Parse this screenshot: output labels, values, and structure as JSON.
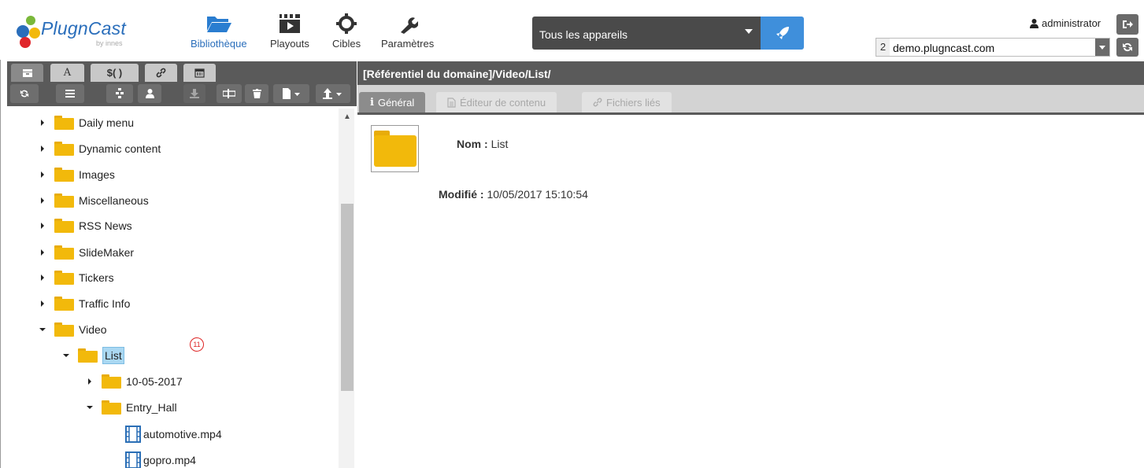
{
  "header": {
    "logo": {
      "brand": "PlugnCast",
      "sub": "by innes"
    },
    "nav": [
      {
        "label": "Bibliothèque",
        "icon": "folder-open-icon",
        "active": true
      },
      {
        "label": "Playouts",
        "icon": "film-clapper-icon"
      },
      {
        "label": "Cibles",
        "icon": "crosshair-icon"
      },
      {
        "label": "Paramètres",
        "icon": "wrench-icon"
      }
    ],
    "device_select": {
      "value": "Tous les appareils"
    },
    "user": "administrator",
    "domain": {
      "number": "2",
      "value": "demo.plugncast.com"
    }
  },
  "left": {
    "tabs": [
      {
        "icon": "inbox-icon",
        "label": ""
      },
      {
        "icon": "text-a-icon",
        "label": "A"
      },
      {
        "icon": "variable-icon",
        "label": "$( )"
      },
      {
        "icon": "link-icon",
        "label": ""
      },
      {
        "icon": "calendar-icon",
        "label": ""
      }
    ],
    "tree": [
      {
        "label": "Daily menu"
      },
      {
        "label": "Dynamic content"
      },
      {
        "label": "Images"
      },
      {
        "label": "Miscellaneous"
      },
      {
        "label": "RSS News"
      },
      {
        "label": "SlideMaker"
      },
      {
        "label": "Tickers"
      },
      {
        "label": "Traffic Info"
      },
      {
        "label": "Video"
      },
      {
        "label": "List"
      },
      {
        "label": "10-05-2017"
      },
      {
        "label": "Entry_Hall"
      },
      {
        "label": "automotive.mp4"
      },
      {
        "label": "gopro.mp4"
      }
    ],
    "marker": "11"
  },
  "right": {
    "path": "[Référentiel du domaine]/Video/List/",
    "tabs": [
      {
        "label": "Général",
        "icon_text": "i"
      },
      {
        "label": "Éditeur de contenu"
      },
      {
        "label": "Fichiers liés"
      }
    ],
    "name_label": "Nom :",
    "name_value": "List",
    "modified_label": "Modifié :",
    "modified_value": "10/05/2017 15:10:54"
  },
  "colors": {
    "accent": "#3f8fdb",
    "folder": "#f2b90b",
    "bar": "#5a5a5a",
    "selection": "#aad8f2"
  }
}
